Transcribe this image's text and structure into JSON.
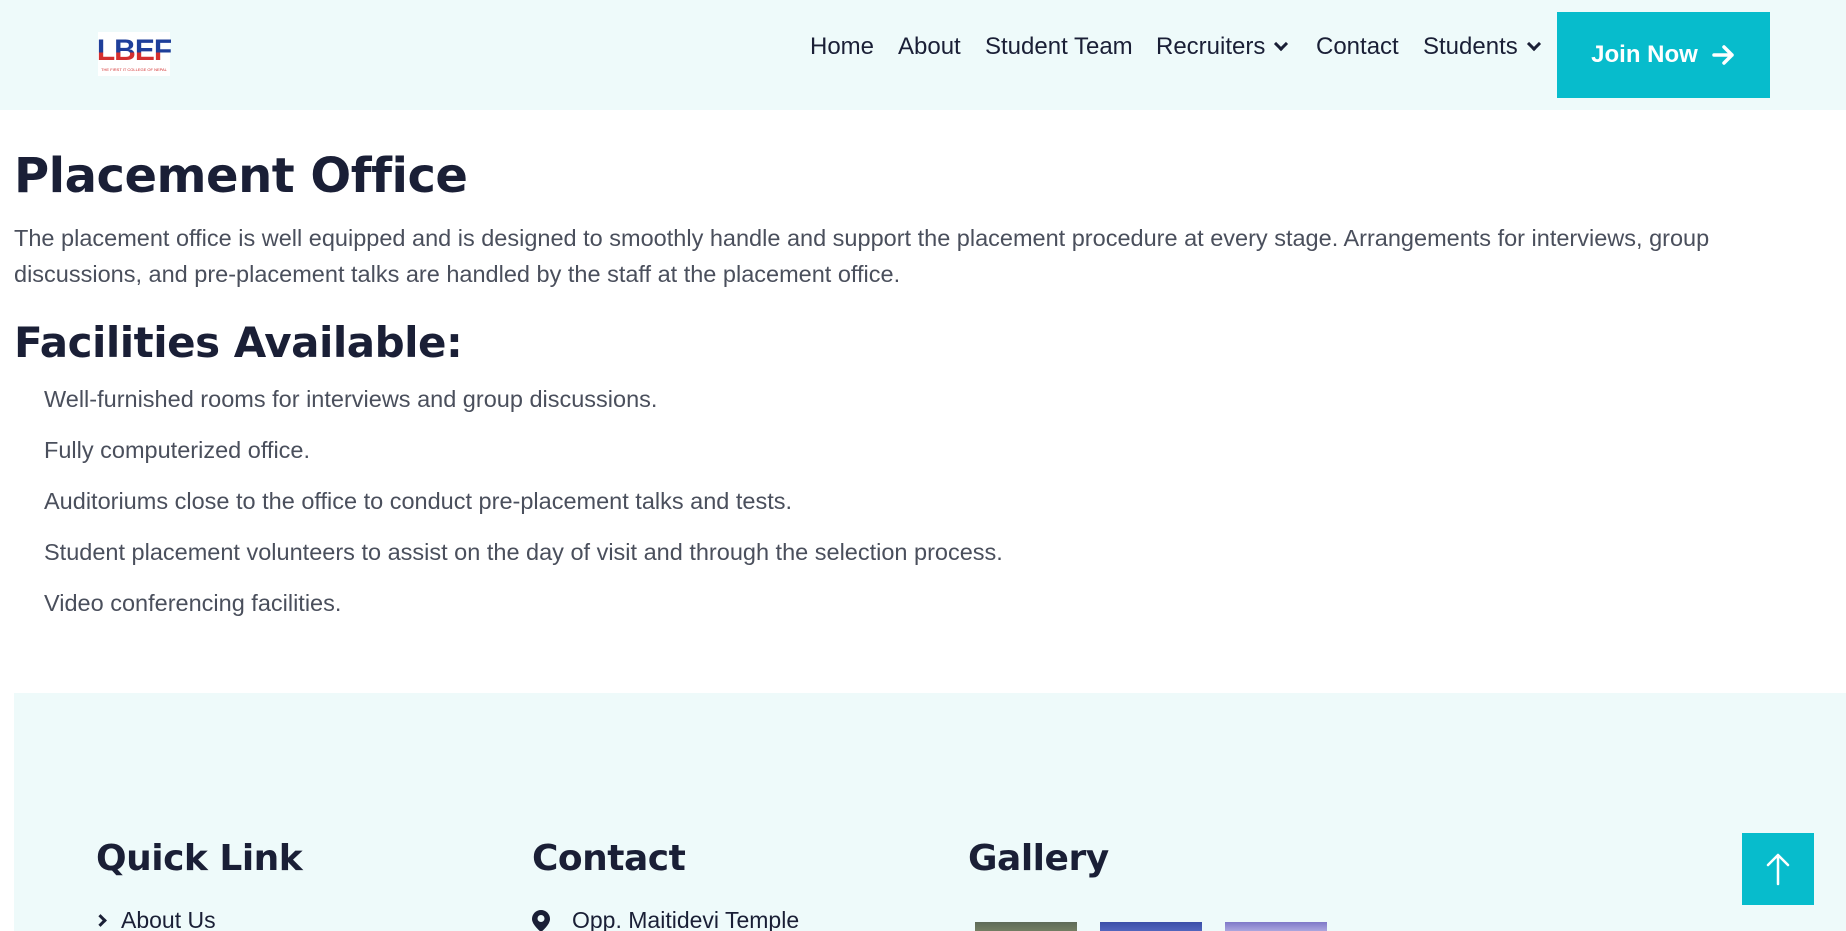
{
  "header": {
    "logo": {
      "text": "LBEF",
      "tagline": "THE FIRST IT COLLEGE OF NEPAL"
    },
    "nav": [
      {
        "label": "Home"
      },
      {
        "label": "About"
      },
      {
        "label": "Student Team"
      },
      {
        "label": "Recruiters",
        "has_dropdown": true
      },
      {
        "label": "Contact"
      },
      {
        "label": "Students",
        "has_dropdown": true
      }
    ],
    "cta": {
      "label": "Join Now",
      "icon": "arrow-right-icon"
    }
  },
  "main": {
    "title": "Placement Office",
    "intro": "The placement office is well equipped and is designed to smoothly handle and support the placement procedure at every stage. Arrangements for interviews, group discussions, and pre-placement talks are handled by the staff at the placement office.",
    "facilities_title": "Facilities Available:",
    "facilities": [
      "Well-furnished rooms for interviews and group discussions.",
      "Fully computerized office.",
      "Auditoriums close to the office to conduct pre-placement talks and tests.",
      "Student placement volunteers to assist on the day of visit and through the selection process.",
      "Video conferencing facilities."
    ]
  },
  "footer": {
    "quick_link": {
      "heading": "Quick Link",
      "items": [
        "About Us"
      ]
    },
    "contact": {
      "heading": "Contact",
      "address": "Opp. Maitidevi Temple"
    },
    "gallery": {
      "heading": "Gallery"
    }
  },
  "colors": {
    "accent": "#07bccc",
    "header_bg": "#eefafa",
    "text_dark": "#1a1f36",
    "text_body": "#4a4f5c"
  }
}
